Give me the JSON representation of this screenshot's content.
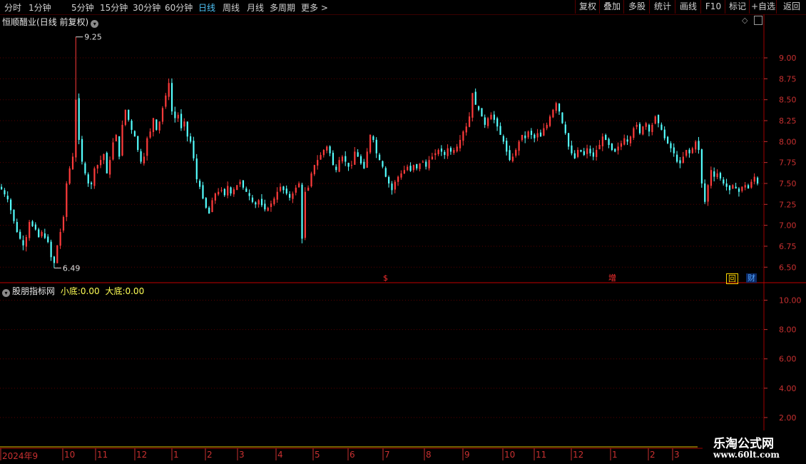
{
  "toolbar": {
    "periods": [
      "分时",
      "1分钟",
      "5分钟",
      "15分钟",
      "30分钟",
      "60分钟",
      "日线",
      "周线",
      "月线",
      "多周期",
      "更多 >"
    ],
    "active_period": "日线",
    "buttons": [
      "复权",
      "叠加",
      "多股",
      "统计",
      "画线",
      "F10",
      "标记",
      "+自选",
      "返回"
    ]
  },
  "main_chart": {
    "stock_name": "恒顺醋业",
    "subtitle": "(日线 前复权)",
    "high_label": "9.25",
    "low_label": "6.49",
    "y_ticks": [
      "9.00",
      "8.75",
      "8.50",
      "8.25",
      "8.00",
      "7.75",
      "7.50",
      "7.25",
      "7.00",
      "6.75",
      "6.50"
    ],
    "events": [
      {
        "label": "$",
        "color": "#ff3030"
      },
      {
        "label": "增",
        "color": "#ff3030"
      },
      {
        "label": "回",
        "color": "#ffd700"
      },
      {
        "label": "财",
        "color": "#4fa3ff"
      }
    ],
    "colors": {
      "up": "#ff3b3b",
      "down": "#54ffff",
      "axis": "#c83030",
      "grid": "#5a0000"
    }
  },
  "indicator": {
    "name": "股朋指标网",
    "line1_label": "小底:",
    "line1_value": "0.00",
    "line2_label": "大底:",
    "line2_value": "0.00",
    "y_ticks": [
      "10.00",
      "8.00",
      "6.00",
      "4.00",
      "2.00"
    ]
  },
  "x_axis": {
    "labels": [
      "2024年9",
      "10",
      "11",
      "12",
      "1",
      "2",
      "3",
      "4",
      "5",
      "6",
      "7",
      "8",
      "9",
      "10",
      "11",
      "12",
      "1",
      "2",
      "3"
    ]
  },
  "watermark": {
    "line1": "乐淘公式网",
    "line2": "www.60lt.com"
  },
  "chart_data": {
    "type": "candlestick",
    "title": "恒顺醋业",
    "ylim": [
      6.4,
      9.35
    ],
    "series": [
      {
        "name": "close",
        "values": [
          7.43,
          7.37,
          7.31,
          7.18,
          7.05,
          6.92,
          6.84,
          6.76,
          6.86,
          7.04,
          6.99,
          6.95,
          6.86,
          6.92,
          6.85,
          6.8,
          6.62,
          6.55,
          6.76,
          6.92,
          7.1,
          7.5,
          7.68,
          7.82,
          8.5,
          8.02,
          7.76,
          7.62,
          7.5,
          7.49,
          7.68,
          7.72,
          7.78,
          7.85,
          7.62,
          7.78,
          7.99,
          8.08,
          7.82,
          8.2,
          8.38,
          8.26,
          8.14,
          8.06,
          7.9,
          7.76,
          7.82,
          8.04,
          8.12,
          8.28,
          8.14,
          8.24,
          8.4,
          8.55,
          8.7,
          8.36,
          8.28,
          8.32,
          8.16,
          8.24,
          8.06,
          8.0,
          7.8,
          7.55,
          7.46,
          7.32,
          7.21,
          7.14,
          7.3,
          7.38,
          7.4,
          7.42,
          7.36,
          7.47,
          7.38,
          7.43,
          7.48,
          7.52,
          7.45,
          7.4,
          7.35,
          7.28,
          7.25,
          7.3,
          7.24,
          7.19,
          7.21,
          7.26,
          7.32,
          7.4,
          7.46,
          7.42,
          7.38,
          7.33,
          7.38,
          7.45,
          7.5,
          6.84,
          7.4,
          7.45,
          7.62,
          7.72,
          7.78,
          7.84,
          7.9,
          7.94,
          7.86,
          7.72,
          7.66,
          7.78,
          7.82,
          7.76,
          7.7,
          7.72,
          7.88,
          7.82,
          7.74,
          7.68,
          7.88,
          8.08,
          8.02,
          7.86,
          7.78,
          7.7,
          7.58,
          7.5,
          7.42,
          7.52,
          7.58,
          7.62,
          7.66,
          7.7,
          7.65,
          7.72,
          7.68,
          7.74,
          7.76,
          7.7,
          7.78,
          7.82,
          7.86,
          7.9,
          7.88,
          7.84,
          7.92,
          7.88,
          7.9,
          7.94,
          8.02,
          8.12,
          8.18,
          8.3,
          8.58,
          8.44,
          8.38,
          8.3,
          8.2,
          8.28,
          8.32,
          8.26,
          8.18,
          8.08,
          8.0,
          7.88,
          7.78,
          7.82,
          7.9,
          8.0,
          8.08,
          8.04,
          8.12,
          8.08,
          8.04,
          8.1,
          8.06,
          8.16,
          8.2,
          8.3,
          8.38,
          8.46,
          8.36,
          8.22,
          8.1,
          7.94,
          7.86,
          7.8,
          7.9,
          7.88,
          7.84,
          7.92,
          7.86,
          7.82,
          7.9,
          7.96,
          8.06,
          8.02,
          7.96,
          7.9,
          7.88,
          7.94,
          7.98,
          8.04,
          8.0,
          8.06,
          8.16,
          8.2,
          8.1,
          8.18,
          8.22,
          8.12,
          8.2,
          8.3,
          8.22,
          8.14,
          8.04,
          7.98,
          7.92,
          7.86,
          7.76,
          7.74,
          7.82,
          7.9,
          7.86,
          7.92,
          8.0,
          7.9,
          7.5,
          7.28,
          7.48,
          7.66,
          7.58,
          7.62,
          7.56,
          7.5,
          7.46,
          7.42,
          7.48,
          7.44,
          7.4,
          7.46,
          7.48,
          7.44,
          7.52,
          7.58,
          7.5
        ]
      },
      {
        "name": "high",
        "values": [
          9.25
        ]
      },
      {
        "name": "low",
        "values": [
          6.49
        ]
      }
    ]
  }
}
